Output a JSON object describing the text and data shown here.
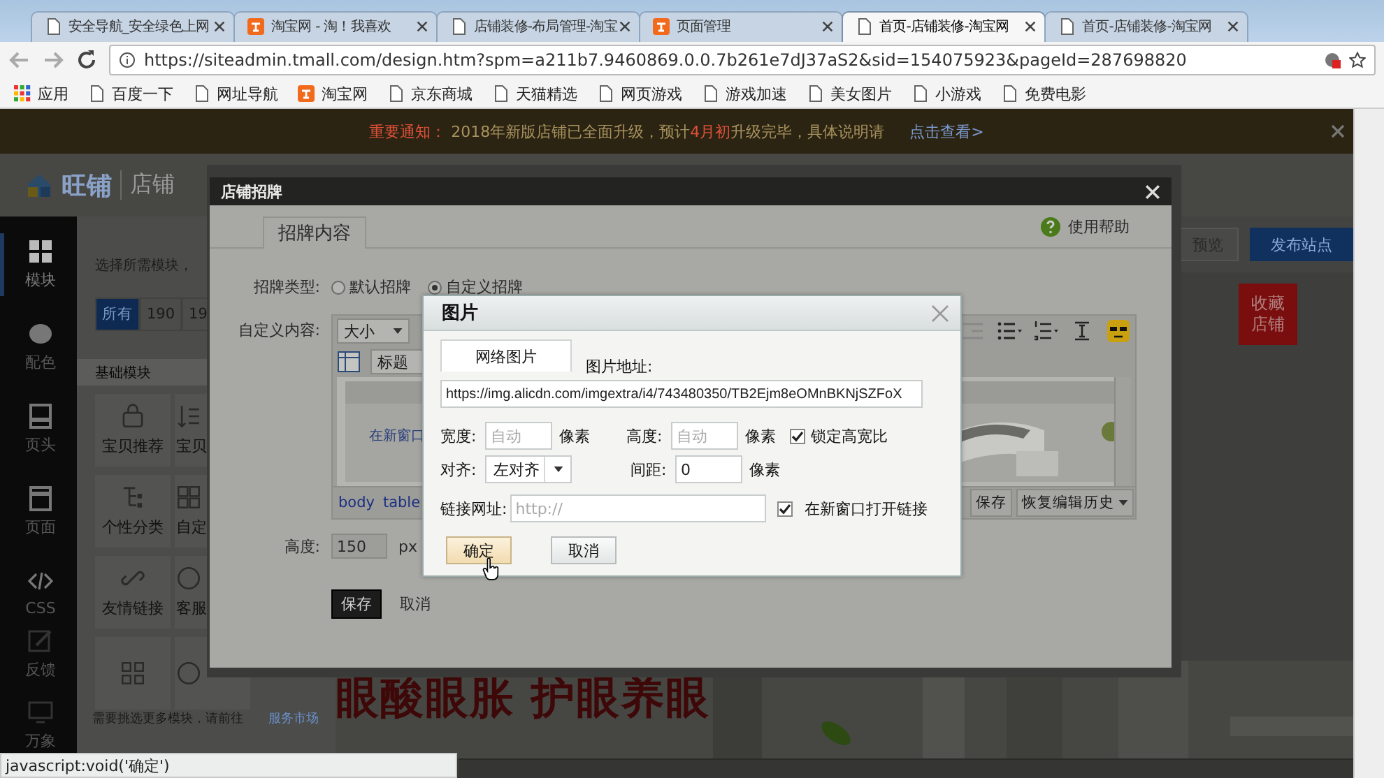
{
  "browser_tabs": [
    {
      "title": "安全导航_安全绿色上网",
      "kind": "page",
      "selected": false
    },
    {
      "title": "淘宝网 - 淘！我喜欢",
      "kind": "site",
      "selected": false
    },
    {
      "title": "店铺装修-布局管理-淘宝",
      "kind": "page",
      "selected": false
    },
    {
      "title": "页面管理",
      "kind": "site",
      "selected": false
    },
    {
      "title": "首页-店铺装修-淘宝网",
      "kind": "page",
      "selected": true
    },
    {
      "title": "首页-店铺装修-淘宝网",
      "kind": "page",
      "selected": false
    }
  ],
  "address_bar": {
    "url": "https://siteadmin.tmall.com/design.htm?spm=a211b7.9460869.0.0.7b261e7dJ37aS2&sid=154075923&pageId=287698820"
  },
  "bookmarks": [
    {
      "label": "应用",
      "kind": "apps"
    },
    {
      "label": "百度一下",
      "kind": "page"
    },
    {
      "label": "网址导航",
      "kind": "page"
    },
    {
      "label": "淘宝网",
      "kind": "site"
    },
    {
      "label": "京东商城",
      "kind": "page"
    },
    {
      "label": "天猫精选",
      "kind": "page"
    },
    {
      "label": "网页游戏",
      "kind": "page"
    },
    {
      "label": "游戏加速",
      "kind": "page"
    },
    {
      "label": "美女图片",
      "kind": "page"
    },
    {
      "label": "小游戏",
      "kind": "page"
    },
    {
      "label": "免费电影",
      "kind": "page"
    }
  ],
  "notice": {
    "parts": [
      {
        "text": "重要通知：",
        "kind": "alert"
      },
      {
        "text": " 2018年新版店铺已全面升级，预计",
        "kind": "plain"
      },
      {
        "text": "4月初",
        "kind": "alert"
      },
      {
        "text": "升级完毕，具体说明请",
        "kind": "plain"
      },
      {
        "text": "点击查看>",
        "kind": "link"
      }
    ]
  },
  "header": {
    "brand": "旺铺",
    "section": "店铺"
  },
  "sidebar": {
    "items": [
      {
        "label": "模块",
        "kind": "modules",
        "selected": true
      },
      {
        "label": "配色",
        "kind": "colors",
        "selected": false
      },
      {
        "label": "页头",
        "kind": "header",
        "selected": false
      },
      {
        "label": "页面",
        "kind": "page",
        "selected": false
      },
      {
        "label": "CSS",
        "kind": "code",
        "selected": false
      }
    ],
    "bottom_items": [
      {
        "label": "反馈",
        "kind": "feedback"
      },
      {
        "label": "万象",
        "kind": "screen"
      }
    ]
  },
  "module_panel": {
    "hint": "选择所需模块，",
    "filters": [
      {
        "label": "所有",
        "selected": true
      },
      {
        "label": "190",
        "selected": false
      },
      {
        "label": "19",
        "selected": false
      }
    ],
    "section": "基础模块",
    "tiles": [
      {
        "label": "宝贝推荐",
        "kind": "bag"
      },
      {
        "label": "宝贝",
        "kind": "sort"
      },
      {
        "label": "个性分类",
        "kind": "category"
      },
      {
        "label": "自定",
        "kind": "grid"
      },
      {
        "label": "友情链接",
        "kind": "link"
      },
      {
        "label": "客服",
        "kind": "service"
      },
      {
        "kind": "qr"
      },
      {
        "kind": "coin"
      }
    ],
    "footer": "需要挑选更多模块，请前往",
    "footer_link": "服务市场"
  },
  "top_actions": [
    "预览",
    "发布站点"
  ],
  "favorite_badge": "收藏店铺",
  "banner": {
    "headline": "眼酸眼胀 护眼养眼"
  },
  "sign_dialog": {
    "title": "店铺招牌",
    "tabs": [
      {
        "label": "招牌内容",
        "selected": true
      }
    ],
    "help": "使用帮助",
    "type_label": "招牌类型:",
    "type_options": [
      {
        "label": "默认招牌",
        "selected": false
      },
      {
        "label": "自定义招牌",
        "selected": true
      }
    ],
    "content_label": "自定义内容:",
    "editor": {
      "size_select": "大小",
      "heading_select": "标题",
      "link_text": "在新窗口",
      "path": [
        "body",
        "table"
      ],
      "save_button": "保存",
      "history_button": "恢复编辑历史"
    },
    "height_label": "高度:",
    "height_value": "150",
    "height_unit": "px",
    "buttons": [
      "保存",
      "取消"
    ]
  },
  "image_dialog": {
    "title": "图片",
    "tabs": [
      {
        "label": "网络图片",
        "selected": true
      }
    ],
    "url_label": "图片地址:",
    "url_value": "https://img.alicdn.com/imgextra/i4/743480350/TB2Ejm8eOMnBKNjSZFoX",
    "width_label": "宽度:",
    "width_placeholder": "自动",
    "width_unit": "像素",
    "height_label": "高度:",
    "height_placeholder": "自动",
    "height_unit": "像素",
    "lock_ratio": {
      "label": "锁定高宽比",
      "checked": true
    },
    "align_label": "对齐:",
    "align_value": "左对齐",
    "spacing_label": "间距:",
    "spacing_value": "0",
    "spacing_unit": "像素",
    "link_label": "链接网址:",
    "link_placeholder": "http://",
    "new_window": {
      "label": "在新窗口打开链接",
      "checked": true
    },
    "buttons": [
      {
        "label": "确定",
        "hovered": true
      },
      {
        "label": "取消",
        "hovered": false
      }
    ]
  },
  "status_bar": "javascript:void('确定')"
}
